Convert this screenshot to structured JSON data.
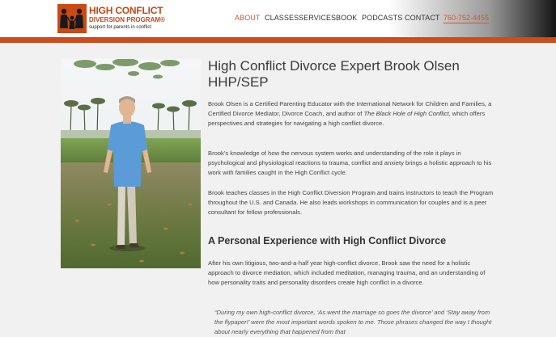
{
  "logo": {
    "line1": "HIGH CONFLICT",
    "line2": "DIVERSION PROGRAM®",
    "line3": "support for parents in conflict",
    "icon": "family-silhouette-icon"
  },
  "nav": {
    "items": [
      {
        "label": "ABOUT",
        "active": true
      },
      {
        "label": "CLASSES",
        "active": false
      },
      {
        "label": "SERVICES",
        "active": false
      },
      {
        "label": "BOOK",
        "active": false
      },
      {
        "label": "PODCASTS",
        "active": false
      },
      {
        "label": "CONTACT",
        "active": false
      }
    ],
    "phone": "760-752-4455"
  },
  "colors": {
    "accent": "#cf4a1c",
    "text": "#333333"
  },
  "article": {
    "title": "High Conflict Divorce Expert Brook Olsen HHP/SEP",
    "p1_a": "Brook Olsen is a Certified Parenting Educator with the International Network for Children and Families, a Certified Divorce Mediator, Divorce Coach, and author of ",
    "p1_em": "The Black Hole of High Conflict",
    "p1_b": ", which offers perspectives and strategies for navigating a high conflict divorce.",
    "p2": "Brook’s knowledge of how the nervous system works and understanding of the role it plays in psychological and physiological reactions to trauma, conflict and anxiety brings a holistic approach to his work with families caught in the High Conflict cycle.",
    "p3": "Brook teaches classes in the High Conflict Diversion Program and trains instructors to teach the Program throughout the U.S. and Canada. He also leads workshops in communication for couples and is a peer consultant for fellow professionals.",
    "subheading": "A Personal Experience with High Conflict Divorce",
    "p4": "After his own litigious, two-and-a-half year high-conflict divorce, Brook  saw the need for a holistic approach to divorce mediation, which included meditation, managing trauma, and an understanding of how personality traits and personality disorders create high conflict in a divorce.",
    "quote": "“During my own high-conflict divorce, ‘As went the marriage so goes the divorce’ and ‘Stay away from the flypaper!’ were the most important words spoken to me. Those phrases changed the way I thought about nearly everything that happened from that"
  }
}
